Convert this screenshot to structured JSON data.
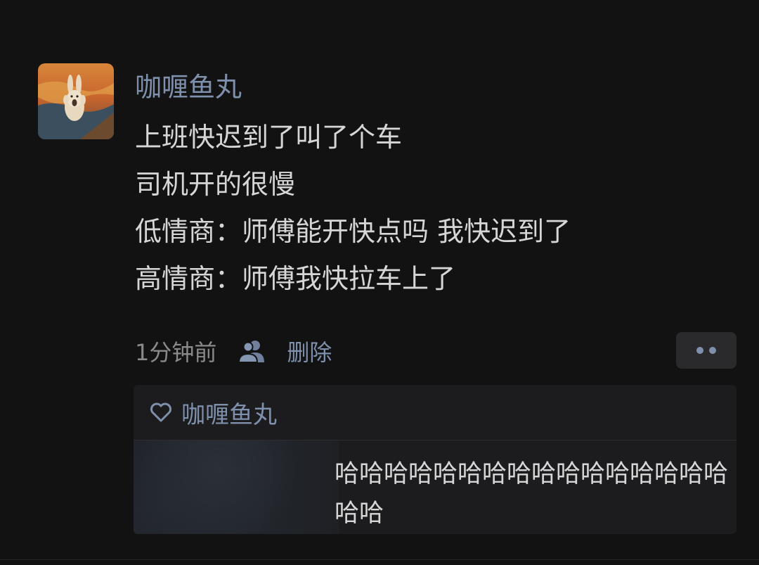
{
  "post": {
    "author": "咖喱鱼丸",
    "avatar_icon": "rabbit-scream-painting-avatar",
    "lines": [
      "上班快迟到了叫了个车",
      "司机开的很慢",
      "低情商：师傅能开快点吗 我快迟到了",
      "高情商：师傅我快拉车上了"
    ],
    "timestamp": "1分钟前",
    "visibility_icon": "people-icon",
    "delete_label": "删除",
    "more_icon": "more-dots-icon"
  },
  "likes": {
    "icon": "heart-icon",
    "names": "咖喱鱼丸"
  },
  "comment": {
    "text": "哈哈哈哈哈哈哈哈哈哈哈哈哈哈哈哈哈哈"
  },
  "colors": {
    "background": "#121212",
    "link_blue": "#7f90ad",
    "text": "#d6d6d6",
    "muted": "#8a8a8a",
    "panel": "#1c1c1e"
  }
}
